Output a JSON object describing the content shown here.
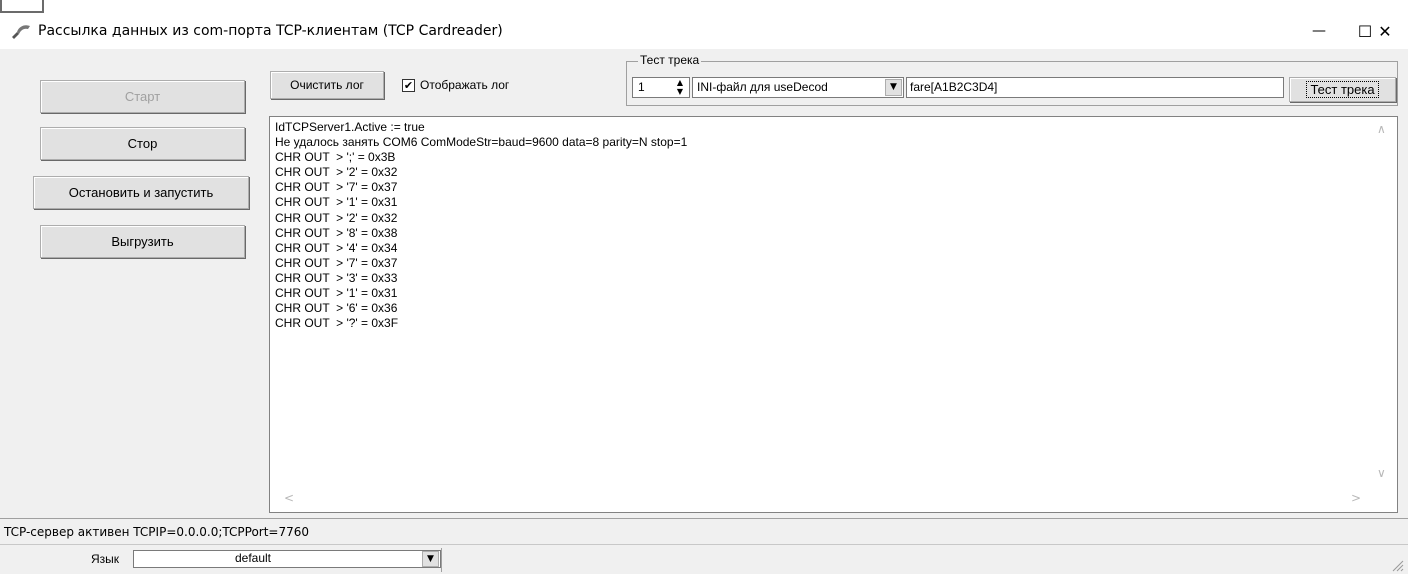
{
  "window": {
    "title": "Рассылка данных из com-порта TCP-клиентам (TCP Cardreader)",
    "controls": {
      "minimize": "—",
      "maximize": "☐",
      "close": "✕"
    }
  },
  "left_buttons": {
    "start": "Старт",
    "stop": "Стор",
    "restart": "Остановить и запустить",
    "unload": "Выгрузить"
  },
  "toolbar": {
    "clear_log": "Очистить лог",
    "show_log_label": "Отображать лог",
    "show_log_checked": true,
    "show_log_mark": "✔"
  },
  "track_test": {
    "group_caption": "Тест трека",
    "spin_value": "1",
    "ini_selected": "INI-файл для useDecod",
    "track_value": "fare[A1B2C3D4]",
    "test_button": "Тест трека"
  },
  "log": {
    "lines": [
      "IdTCPServer1.Active := true",
      "Не удалось занять COM6 ComModeStr=baud=9600 data=8 parity=N stop=1",
      "CHR OUT  > ';' = 0x3B",
      "CHR OUT  > '2' = 0x32",
      "CHR OUT  > '7' = 0x37",
      "CHR OUT  > '1' = 0x31",
      "CHR OUT  > '2' = 0x32",
      "CHR OUT  > '8' = 0x38",
      "CHR OUT  > '4' = 0x34",
      "CHR OUT  > '7' = 0x37",
      "CHR OUT  > '3' = 0x33",
      "CHR OUT  > '1' = 0x31",
      "CHR OUT  > '6' = 0x36",
      "CHR OUT  > '?' = 0x3F"
    ]
  },
  "status": {
    "text": "TCP-сервер активен  TCPIP=0.0.0.0;TCPPort=7760",
    "language_label": "Язык",
    "language_value": "default"
  },
  "colors": {
    "window_bg": "#f0f0f0",
    "button_bg": "#e1e1e1",
    "disabled_text": "#a0a0a0"
  }
}
